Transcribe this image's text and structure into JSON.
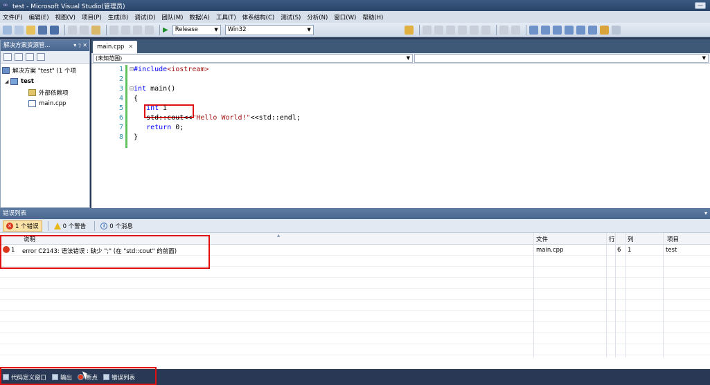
{
  "window": {
    "title": "test - Microsoft Visual Studio(管理员)",
    "minimize": "—"
  },
  "menu": [
    "文件(F)",
    "编辑(E)",
    "视图(V)",
    "项目(P)",
    "生成(B)",
    "调试(D)",
    "团队(M)",
    "数据(A)",
    "工具(T)",
    "体系结构(C)",
    "测试(S)",
    "分析(N)",
    "窗口(W)",
    "帮助(H)"
  ],
  "toolbar": {
    "configuration": "Release",
    "platform": "Win32"
  },
  "solution_explorer": {
    "title": "解决方案资源管...",
    "controls": "▾ ⁊ ✕",
    "solution": "解决方案 \"test\" (1 个项",
    "project": "test",
    "external_deps": "外部依赖项",
    "file": "main.cpp"
  },
  "editor": {
    "tab": "main.cpp",
    "tab_close": "✕",
    "scope": "(未知范围)",
    "lines": [
      {
        "n": "1",
        "parts": [
          {
            "t": "⊟",
            "c": "fold"
          },
          {
            "t": "#include",
            "c": "pp"
          },
          {
            "t": "<iostream>",
            "c": "inc"
          }
        ]
      },
      {
        "n": "2",
        "parts": []
      },
      {
        "n": "3",
        "parts": [
          {
            "t": "⊟",
            "c": "fold"
          },
          {
            "t": "int",
            "c": "kw"
          },
          {
            "t": " main()",
            "c": ""
          }
        ]
      },
      {
        "n": "4",
        "parts": [
          {
            "t": " {",
            "c": ""
          }
        ]
      },
      {
        "n": "5",
        "parts": [
          {
            "t": "    ",
            "c": ""
          },
          {
            "t": "int",
            "c": "kw"
          },
          {
            "t": " i",
            "c": ""
          }
        ]
      },
      {
        "n": "6",
        "parts": [
          {
            "t": "    std::cout<<",
            "c": ""
          },
          {
            "t": "\"Hello World!\"",
            "c": "str"
          },
          {
            "t": "<<std::endl;",
            "c": ""
          }
        ]
      },
      {
        "n": "7",
        "parts": [
          {
            "t": "    ",
            "c": ""
          },
          {
            "t": "return",
            "c": "kw"
          },
          {
            "t": " 0;",
            "c": ""
          }
        ]
      },
      {
        "n": "8",
        "parts": [
          {
            "t": " }",
            "c": ""
          }
        ]
      }
    ]
  },
  "error_list": {
    "title": "错误列表",
    "dropdown": "▾",
    "filter_errors": "1 个错误",
    "filter_warnings": "0 个警告",
    "filter_messages": "0 个消息",
    "columns": {
      "desc": "说明",
      "file": "文件",
      "line": "行",
      "col": "列",
      "project": "项目"
    },
    "rows": [
      {
        "num": "1",
        "desc": "error C2143: 语法错误 : 缺少 \";\" (在 \"std::cout\" 的前面)",
        "file": "main.cpp",
        "line": "6",
        "col": "1",
        "project": "test"
      }
    ]
  },
  "status_bar": [
    "代码定义窗口",
    "输出",
    "断点",
    "错误列表"
  ],
  "colors": {
    "highlight_box": "#e01010",
    "chrome": "#293955",
    "line_number": "#2b91af"
  }
}
